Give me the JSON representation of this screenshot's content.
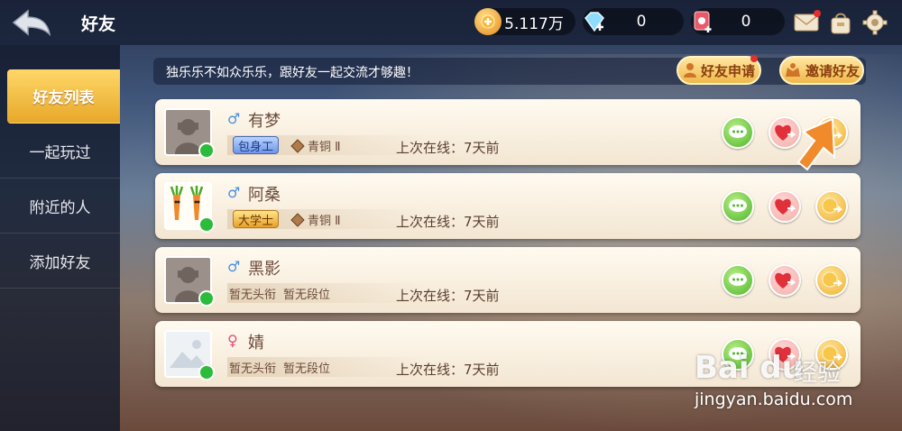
{
  "header": {
    "title": "好友",
    "coins": "5.117万",
    "diamonds": "0",
    "tickets": "0"
  },
  "sidebar": {
    "items": [
      {
        "label": "好友列表",
        "active": true
      },
      {
        "label": "一起玩过",
        "active": false
      },
      {
        "label": "附近的人",
        "active": false
      },
      {
        "label": "添加好友",
        "active": false
      }
    ]
  },
  "main": {
    "tagline": "独乐乐不如众乐乐，跟好友一起交流才够趣！",
    "friend_request_label": "好友申请",
    "invite_label": "邀请好友"
  },
  "friends": [
    {
      "name": "有梦",
      "gender": "♂",
      "title": "包身工",
      "rank": "青铜 Ⅱ",
      "last_online": "上次在线：7天前"
    },
    {
      "name": "阿桑",
      "gender": "♂",
      "title": "大学士",
      "rank": "青铜 Ⅱ",
      "last_online": "上次在线：7天前"
    },
    {
      "name": "黑影",
      "gender": "♂",
      "title": "暂无头衔",
      "rank": "暂无段位",
      "last_online": "上次在线：7天前"
    },
    {
      "name": "婧",
      "gender": "♀",
      "title": "暂无头衔",
      "rank": "暂无段位",
      "last_online": "上次在线：7天前"
    }
  ],
  "colors": {
    "male": "#4a8fe0",
    "female": "#e0507a",
    "accent_gold": "#f0b84a"
  },
  "watermark": {
    "logo": "Bai du",
    "cn": "经验",
    "url": "jingyan.baidu.com"
  }
}
